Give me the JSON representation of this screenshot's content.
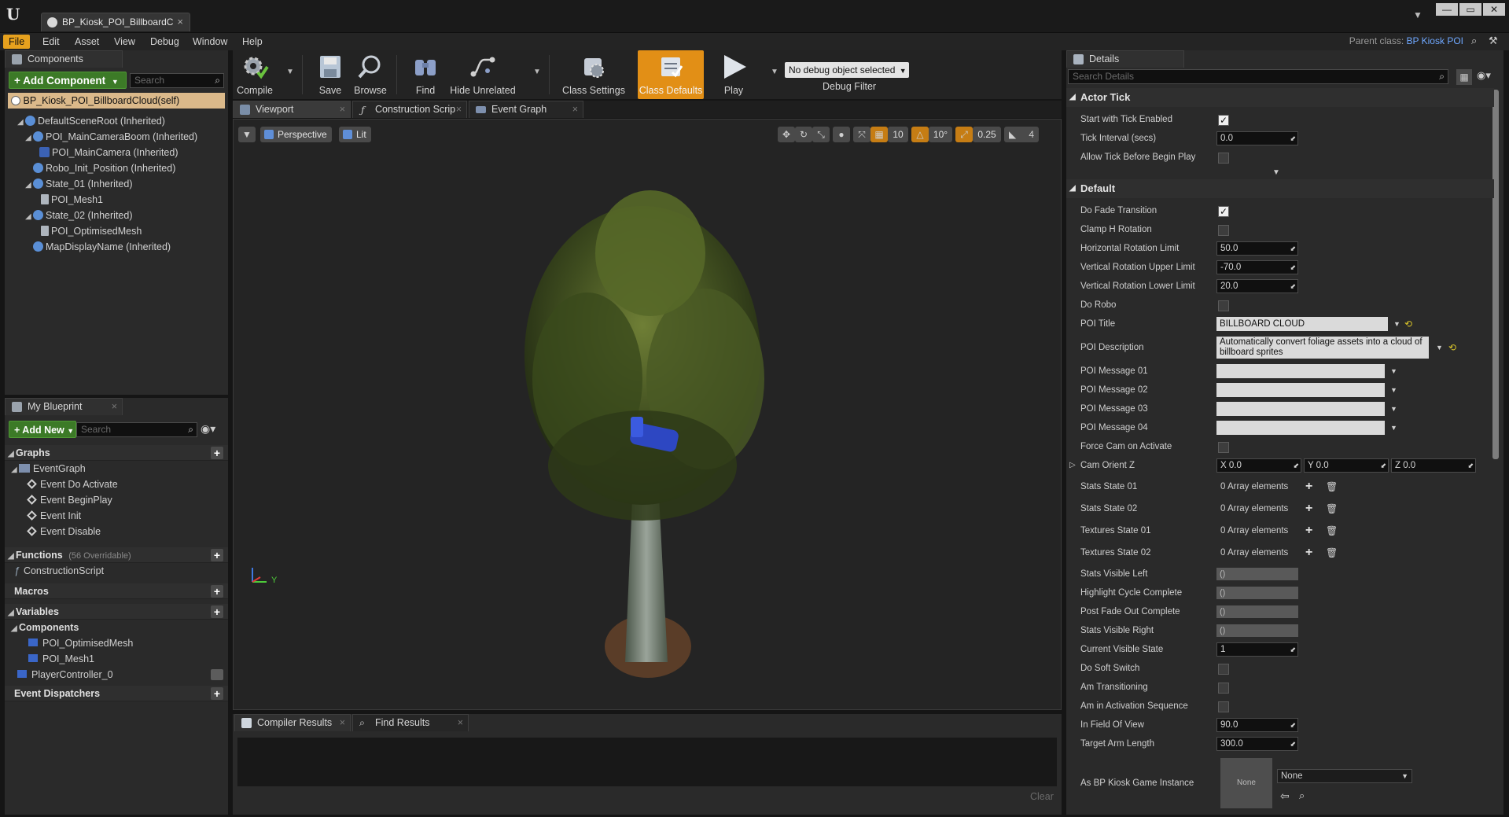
{
  "window": {
    "tab_title": "BP_Kiosk_POI_BillboardC",
    "controls": [
      "—",
      "▭",
      "✕"
    ]
  },
  "menu": {
    "items": [
      "File",
      "Edit",
      "Asset",
      "View",
      "Debug",
      "Window",
      "Help"
    ],
    "parent_class_label": "Parent class:",
    "parent_class_value": "BP Kiosk POI"
  },
  "components_panel": {
    "tab": "Components",
    "add_button": "+ Add Component",
    "search_placeholder": "Search",
    "self_item": "BP_Kiosk_POI_BillboardCloud(self)",
    "tree": [
      {
        "label": "DefaultSceneRoot (Inherited)"
      },
      {
        "label": "POI_MainCameraBoom (Inherited)"
      },
      {
        "label": "POI_MainCamera (Inherited)"
      },
      {
        "label": "Robo_Init_Position (Inherited)"
      },
      {
        "label": "State_01 (Inherited)"
      },
      {
        "label": "POI_Mesh1"
      },
      {
        "label": "State_02 (Inherited)"
      },
      {
        "label": "POI_OptimisedMesh"
      },
      {
        "label": "MapDisplayName (Inherited)"
      }
    ]
  },
  "my_blueprint": {
    "tab": "My Blueprint",
    "add_button": "+ Add New",
    "search_placeholder": "Search",
    "graphs_label": "Graphs",
    "event_graph": "EventGraph",
    "events": [
      "Event Do Activate",
      "Event BeginPlay",
      "Event Init",
      "Event Disable"
    ],
    "functions_label": "Functions",
    "functions_count": "(56 Overridable)",
    "construction_script": "ConstructionScript",
    "macros_label": "Macros",
    "variables_label": "Variables",
    "components_label": "Components",
    "component_vars": [
      "POI_OptimisedMesh",
      "POI_Mesh1"
    ],
    "player_controller": "PlayerController_0",
    "dispatchers_label": "Event Dispatchers"
  },
  "toolbar": {
    "compile": "Compile",
    "save": "Save",
    "browse": "Browse",
    "find": "Find",
    "hide_unrelated": "Hide Unrelated",
    "class_settings": "Class Settings",
    "class_defaults": "Class Defaults",
    "play": "Play",
    "debug_select": "No debug object selected",
    "debug_filter": "Debug Filter"
  },
  "editor_tabs": [
    "Viewport",
    "Construction Scrip",
    "Event Graph"
  ],
  "viewport": {
    "perspective": "Perspective",
    "lit": "Lit",
    "grid_snap": "10",
    "rot_snap": "10°",
    "scale_snap": "0.25",
    "cam_speed": "4",
    "axis_y": "Y"
  },
  "bottom": {
    "tabs": [
      "Compiler Results",
      "Find Results"
    ],
    "clear": "Clear"
  },
  "details": {
    "tab": "Details",
    "search_placeholder": "Search Details",
    "actor_tick": {
      "title": "Actor Tick",
      "start_with_tick": "Start with Tick Enabled",
      "tick_interval": "Tick Interval (secs)",
      "tick_interval_val": "0.0",
      "allow_tick": "Allow Tick Before Begin Play"
    },
    "default": {
      "title": "Default",
      "do_fade": "Do Fade Transition",
      "clamp_h": "Clamp H Rotation",
      "h_rot": "Horizontal Rotation Limit",
      "h_rot_val": "50.0",
      "v_up": "Vertical Rotation Upper Limit",
      "v_up_val": "-70.0",
      "v_low": "Vertical Rotation Lower Limit",
      "v_low_val": "20.0",
      "do_robo": "Do Robo",
      "poi_title": "POI Title",
      "poi_title_val": "BILLBOARD CLOUD",
      "poi_desc": "POI Description",
      "poi_desc_val": "Automatically convert foliage assets into a cloud of billboard sprites",
      "msg1": "POI Message 01",
      "msg2": "POI Message 02",
      "msg3": "POI Message 03",
      "msg4": "POI Message 04",
      "force_cam": "Force Cam on Activate",
      "cam_orient": "Cam Orient Z",
      "x_val": "X  0.0",
      "y_val": "Y  0.0",
      "z_val": "Z  0.0",
      "stats1": "Stats State 01",
      "stats2": "Stats State 02",
      "tex1": "Textures State 01",
      "tex2": "Textures State 02",
      "array_elems": "0 Array elements",
      "stats_left": "Stats Visible Left",
      "highlight": "Highlight Cycle Complete",
      "post_fade": "Post Fade Out Complete",
      "stats_right": "Stats Visible Right",
      "ro_val": "()",
      "cur_state": "Current Visible State",
      "cur_state_val": "1",
      "soft_switch": "Do Soft Switch",
      "transitioning": "Am Transitioning",
      "activation": "Am in Activation Sequence",
      "fov": "In Field Of View",
      "fov_val": "90.0",
      "arm": "Target Arm Length",
      "arm_val": "300.0",
      "game_instance": "As BP Kiosk Game Instance",
      "thumb": "None",
      "none_select": "None"
    }
  }
}
